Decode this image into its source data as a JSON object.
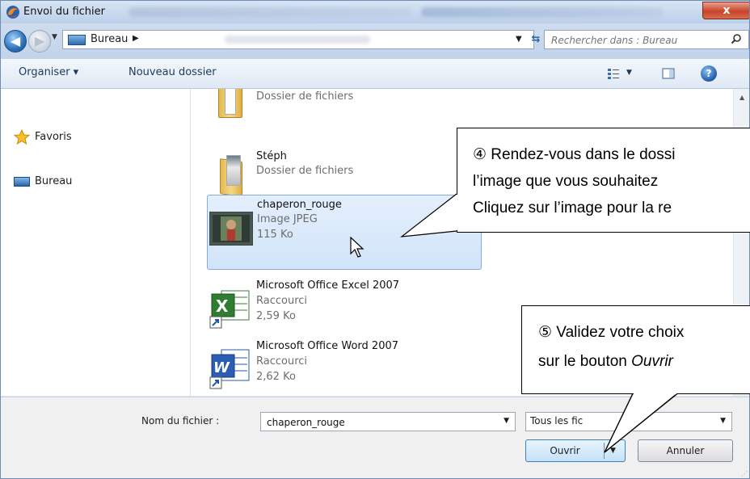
{
  "window": {
    "title": "Envoi du fichier",
    "close_label": "x"
  },
  "address": {
    "location": "Bureau",
    "search_placeholder": "Rechercher dans : Bureau"
  },
  "toolbar": {
    "organize_label": "Organiser ▾",
    "new_folder_label": "Nouveau dossier"
  },
  "nav_pane": {
    "items": [
      {
        "label": "Favoris",
        "icon": "star-icon"
      },
      {
        "label": "Bureau",
        "icon": "desktop-icon"
      }
    ]
  },
  "files": [
    {
      "name": "",
      "type": "Dossier de fichiers",
      "size": "",
      "icon": "folder-icon"
    },
    {
      "name": "Stéph",
      "type": "Dossier de fichiers",
      "size": "",
      "icon": "folder-icon"
    },
    {
      "name": "chaperon_rouge",
      "type": "Image JPEG",
      "size": "115 Ko",
      "icon": "image-thumbnail",
      "selected": true
    },
    {
      "name": "Microsoft Office Excel 2007",
      "type": "Raccourci",
      "size": "2,59 Ko",
      "icon": "excel-icon"
    },
    {
      "name": "Microsoft Office Word 2007",
      "type": "Raccourci",
      "size": "2,62 Ko",
      "icon": "word-icon"
    }
  ],
  "bottom": {
    "filename_label": "Nom du fichier :",
    "filename_value": "chaperon_rouge",
    "filter_value": "Tous les fic",
    "open_label": "Ouvrir",
    "cancel_label": "Annuler"
  },
  "callouts": {
    "step4": {
      "line1": "④ Rendez-vous dans le dossi",
      "line2": "l’image  que  vous  souhaitez",
      "line3": "Cliquez sur l’image pour la re"
    },
    "step5": {
      "line1": "⑤ Validez votre choix",
      "line2_prefix": "sur le bouton ",
      "line2_emph": "Ouvrir"
    }
  }
}
